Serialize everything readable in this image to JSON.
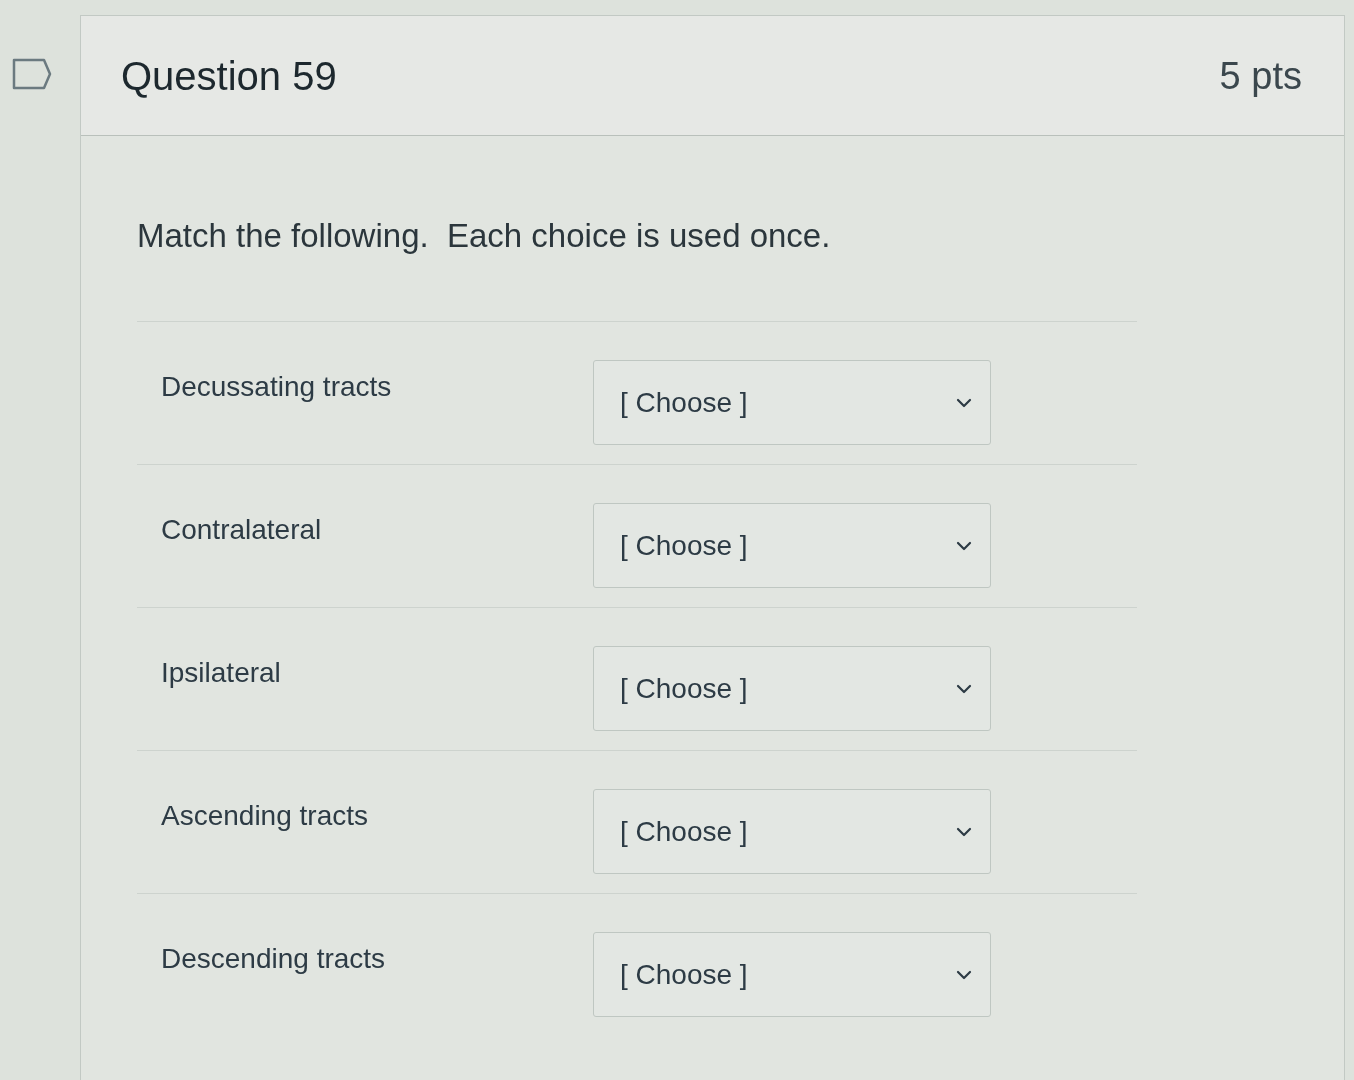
{
  "question": {
    "title": "Question 59",
    "points": "5 pts"
  },
  "prompt": "Match the following.  Each choice is used once.",
  "matches": [
    {
      "label": "Decussating tracts",
      "select": {
        "value": "[ Choose ]"
      }
    },
    {
      "label": "Contralateral",
      "select": {
        "value": "[ Choose ]"
      }
    },
    {
      "label": "Ipsilateral",
      "select": {
        "value": "[ Choose ]"
      }
    },
    {
      "label": "Ascending tracts",
      "select": {
        "value": "[ Choose ]"
      }
    },
    {
      "label": "Descending tracts",
      "select": {
        "value": "[ Choose ]"
      }
    }
  ]
}
